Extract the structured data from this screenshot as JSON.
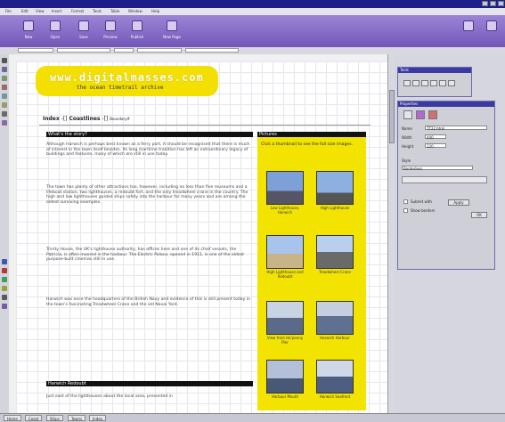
{
  "menu": [
    "File",
    "Edit",
    "View",
    "Insert",
    "Format",
    "Tools",
    "Table",
    "Window",
    "Help"
  ],
  "toolbar": [
    {
      "label": "New",
      "icon": "new-file-icon"
    },
    {
      "label": "Open",
      "icon": "open-folder-icon"
    },
    {
      "label": "Save",
      "icon": "save-icon"
    },
    {
      "label": "Preview",
      "icon": "preview-icon"
    },
    {
      "label": "Publish",
      "icon": "publish-icon"
    },
    {
      "label": "New Page",
      "icon": "new-page-icon"
    }
  ],
  "logo": {
    "title": "www.digitalmasses.com",
    "subtitle": "the ocean timetrail archive"
  },
  "breadcrumb": {
    "first": "Index",
    "sep1": "-[]",
    "second": "Coastlines",
    "sep2": "-[]",
    "third": "Boundary#"
  },
  "main": {
    "heading": "What's the story?",
    "paragraphs": [
      "Although Harwich is perhaps best known as a ferry port, it should be recognised that there is much of interest in the town itself besides. Its long maritime tradition has left an extraordinary legacy of buildings and features, many of which are still in use today.",
      "The town has plenty of other attractions too, however, including no less than five museums and a lifeboat station, two lighthouses, a redoubt fort, and the only treadwheel crane in the country. The high and low lighthouses guided ships safely into the harbour for many years and are among the oldest surviving examples.",
      "Trinity House, the UK's lighthouse authority, has offices here and one of its chief vessels, the Patricia, is often moored in the harbour. The Electric Palace, opened in 1911, is one of the oldest purpose-built cinemas still in use.",
      "Harwich was once the headquarters of the British Navy and evidence of this is still present today in the town's fascinating Treadwheel Crane and the old Naval Yard."
    ],
    "subheading": "Harwich Redoubt",
    "footer_text": "Just east of the lighthouses about the local area, presented in"
  },
  "side": {
    "heading": "Pictures",
    "intro": "Click a thumbnail to see the full size images.",
    "captions": [
      "Low Lighthouse, Harwich",
      "High Lighthouse",
      "High Lighthouse and Redoubt",
      "Treadwheel Crane",
      "View from Ha'penny Pier",
      "Harwich Harbour",
      "Harbour Mouth",
      "Harwich Seafront"
    ]
  },
  "panels": {
    "tools_title": "Tools",
    "props_title": "Properties",
    "props": {
      "name_label": "Name",
      "name_value": "TT22.html",
      "width_label": "Width",
      "width_value": "440",
      "height_label": "Height",
      "height_value": "120",
      "style_label": "Style",
      "style_value": "Borderless",
      "check1": "Submit with",
      "check2": "Show borders",
      "ok": "OK",
      "apply": "Apply"
    }
  },
  "pages": [
    "Home",
    "Coast",
    "Ships",
    "Towns",
    "Index"
  ],
  "colors": {
    "titlebar": "#1d1e8a",
    "toolbar": "#7a5ec0",
    "logo_bg": "#f3e000",
    "side_bg": "#f2e400",
    "heading_bg": "#111111"
  }
}
